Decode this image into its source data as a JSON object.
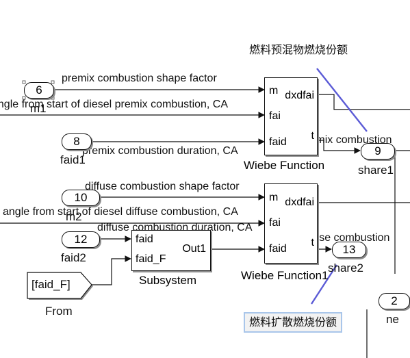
{
  "annotations": {
    "premix_share": "燃料预混物燃烧份额",
    "diffuse_share": "燃料扩散燃烧份额"
  },
  "inports": [
    {
      "number": "6",
      "name": "m1"
    },
    {
      "number": "8",
      "name": "faid1"
    },
    {
      "number": "10",
      "name": "m2"
    },
    {
      "number": "12",
      "name": "faid2"
    },
    {
      "number": "2",
      "name": "ne"
    }
  ],
  "outports": [
    {
      "number": "9",
      "name": "share1"
    },
    {
      "number": "13",
      "name": "share2"
    }
  ],
  "goto_from": {
    "tag": "[faid_F]",
    "name": "From"
  },
  "signals": {
    "s1": "premix combustion shape factor",
    "s2": "angle from start of diesel premix combustion, CA",
    "s3": "premix combustion duration, CA",
    "s4": "fuel premix combustion",
    "s5": "diffuse combustion shape factor",
    "s6": "angle from start of diesel diffuse combustion, CA",
    "s7": "diffuse combustion duration, CA",
    "s8": "fuel diffuse combustion"
  },
  "wiebe1": {
    "name": "Wiebe Function",
    "in_ports": [
      "m",
      "fai",
      "faid"
    ],
    "out_ports": [
      "dxdfai",
      "t"
    ]
  },
  "wiebe2": {
    "name": "Wiebe Function1",
    "in_ports": [
      "m",
      "fai",
      "faid"
    ],
    "out_ports": [
      "dxdfai",
      "t"
    ]
  },
  "subsystem": {
    "name": "Subsystem",
    "in_ports": [
      "faid",
      "faid_F"
    ],
    "out_ports": [
      "Out1"
    ]
  },
  "colors": {
    "annotation_line": "#5b5bd6",
    "annotation_border": "#a9c6ea",
    "shadow": "#8c8c8c"
  }
}
